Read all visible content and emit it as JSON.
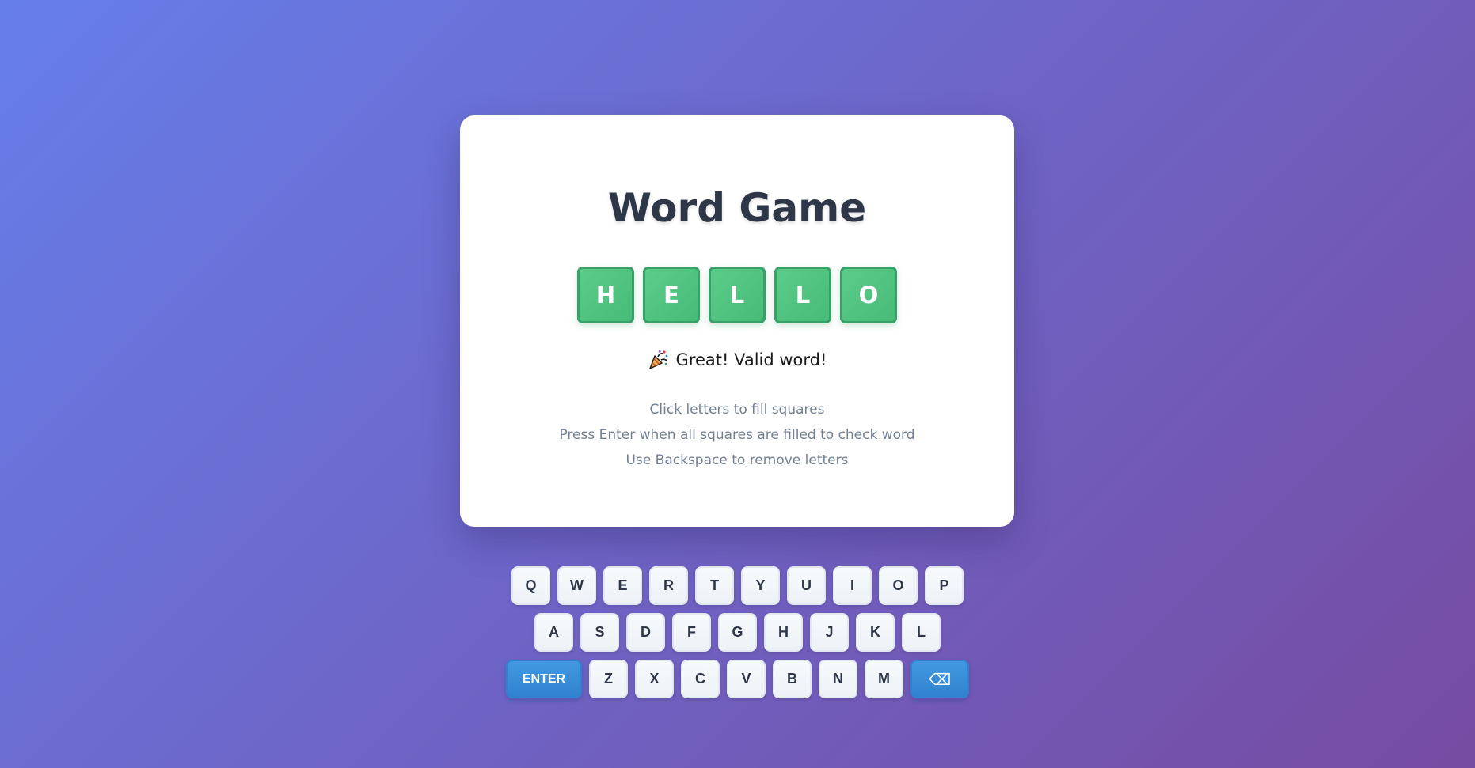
{
  "game": {
    "title": "Word Game",
    "tiles": [
      "H",
      "E",
      "L",
      "L",
      "O"
    ],
    "tile_state": "valid",
    "message_icon": "party-popper-icon",
    "message": "Great! Valid word!",
    "instructions": [
      "Click letters to fill squares",
      "Press Enter when all squares are filled to check word",
      "Use Backspace to remove letters"
    ]
  },
  "keyboard": {
    "row1": [
      "Q",
      "W",
      "E",
      "R",
      "T",
      "Y",
      "U",
      "I",
      "O",
      "P"
    ],
    "row2": [
      "A",
      "S",
      "D",
      "F",
      "G",
      "H",
      "J",
      "K",
      "L"
    ],
    "row3": [
      "Z",
      "X",
      "C",
      "V",
      "B",
      "N",
      "M"
    ],
    "enter_label": "ENTER",
    "backspace_label": "⌫"
  },
  "colors": {
    "background_start": "#667eea",
    "background_end": "#764ba2",
    "tile_valid": "#48bb78",
    "action_key": "#3182ce",
    "title": "#2d3748",
    "instructions": "#718096"
  }
}
